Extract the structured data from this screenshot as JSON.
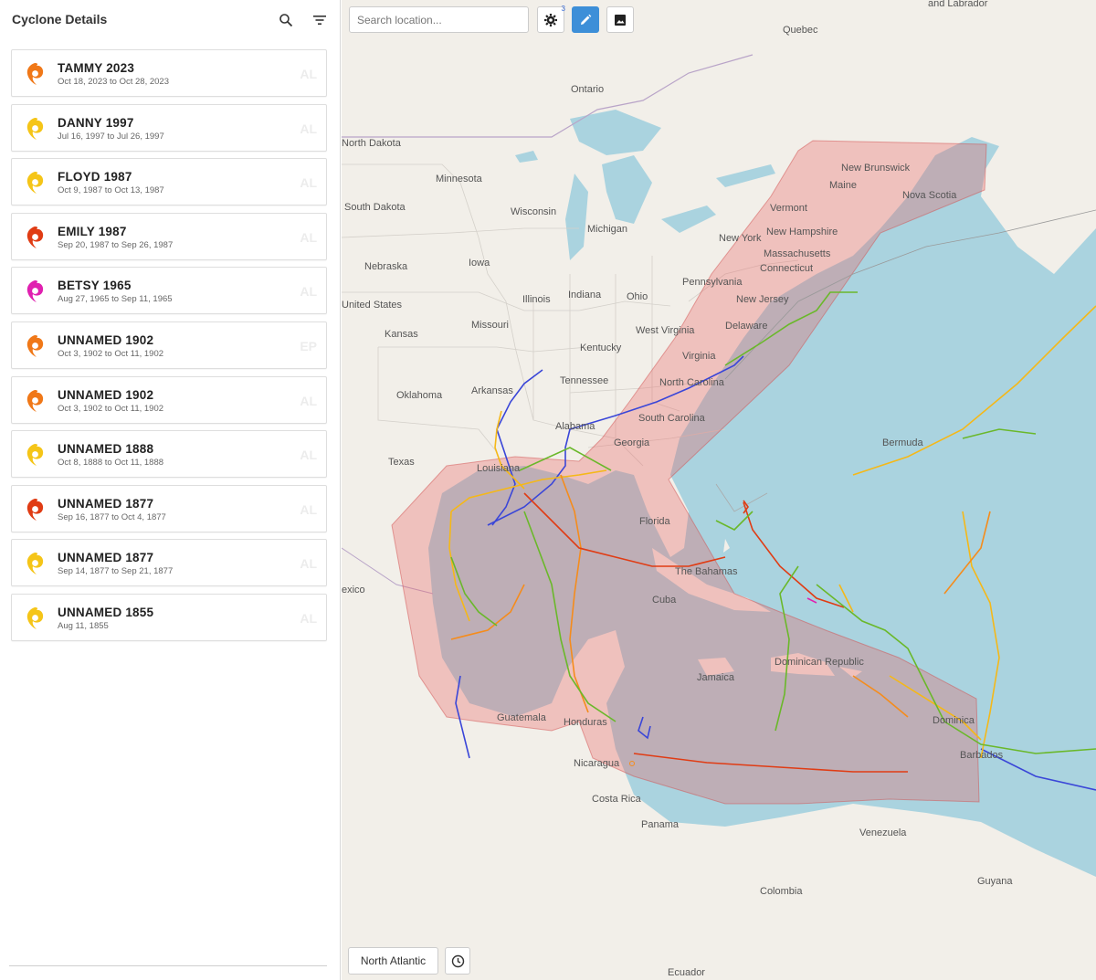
{
  "sidebar": {
    "title": "Cyclone Details",
    "search_icon": "search-icon",
    "filter_icon": "filter-icon"
  },
  "storms": [
    {
      "name": "TAMMY 2023",
      "dates": "Oct 18, 2023 to Oct 28, 2023",
      "basin": "AL",
      "color": "#f07818"
    },
    {
      "name": "DANNY 1997",
      "dates": "Jul 16, 1997 to Jul 26, 1997",
      "basin": "AL",
      "color": "#f5c518"
    },
    {
      "name": "FLOYD 1987",
      "dates": "Oct 9, 1987 to Oct 13, 1987",
      "basin": "AL",
      "color": "#f5c518"
    },
    {
      "name": "EMILY 1987",
      "dates": "Sep 20, 1987 to Sep 26, 1987",
      "basin": "AL",
      "color": "#e03c14"
    },
    {
      "name": "BETSY 1965",
      "dates": "Aug 27, 1965 to Sep 11, 1965",
      "basin": "AL",
      "color": "#e020b0"
    },
    {
      "name": "UNNAMED 1902",
      "dates": "Oct 3, 1902 to Oct 11, 1902",
      "basin": "EP",
      "color": "#f07818"
    },
    {
      "name": "UNNAMED 1902",
      "dates": "Oct 3, 1902 to Oct 11, 1902",
      "basin": "AL",
      "color": "#f07818"
    },
    {
      "name": "UNNAMED 1888",
      "dates": "Oct 8, 1888 to Oct 11, 1888",
      "basin": "AL",
      "color": "#f5c518"
    },
    {
      "name": "UNNAMED 1877",
      "dates": "Sep 16, 1877 to Oct 4, 1877",
      "basin": "AL",
      "color": "#e03c14"
    },
    {
      "name": "UNNAMED 1877",
      "dates": "Sep 14, 1877 to Sep 21, 1877",
      "basin": "AL",
      "color": "#f5c518"
    },
    {
      "name": "UNNAMED 1855",
      "dates": "Aug 11, 1855",
      "basin": "AL",
      "color": "#f5c518"
    }
  ],
  "map": {
    "search_placeholder": "Search location...",
    "settings_badge": "3",
    "settings_icon": "gear-icon",
    "draw_icon": "pencil-icon",
    "image_icon": "image-icon",
    "basin_label": "North Atlantic",
    "history_icon": "clock-icon",
    "labels": {
      "labrador": "and Labrador",
      "quebec": "Quebec",
      "ontario": "Ontario",
      "north_dakota": "North Dakota",
      "minnesota": "Minnesota",
      "south_dakota": "South Dakota",
      "wisconsin": "Wisconsin",
      "michigan": "Michigan",
      "new_brunswick": "New Brunswick",
      "maine": "Maine",
      "nova_scotia": "Nova Scotia",
      "vermont": "Vermont",
      "new_hampshire": "New Hampshire",
      "new_york": "New York",
      "massachusetts": "Massachusetts",
      "connecticut": "Connecticut",
      "nebraska": "Nebraska",
      "iowa": "Iowa",
      "pennsylvania": "Pennsylvania",
      "new_jersey": "New Jersey",
      "illinois": "Illinois",
      "indiana": "Indiana",
      "ohio": "Ohio",
      "united_states": "United States",
      "delaware": "Delaware",
      "missouri": "Missouri",
      "west_virginia": "West Virginia",
      "kansas": "Kansas",
      "kentucky": "Kentucky",
      "virginia": "Virginia",
      "tennessee": "Tennessee",
      "north_carolina": "North Carolina",
      "oklahoma": "Oklahoma",
      "arkansas": "Arkansas",
      "south_carolina": "South Carolina",
      "alabama": "Alabama",
      "georgia": "Georgia",
      "bermuda": "Bermuda",
      "texas": "Texas",
      "louisiana": "Louisiana",
      "florida": "Florida",
      "the_bahamas": "The Bahamas",
      "mexico": "exico",
      "cuba": "Cuba",
      "dominican_republic": "Dominican Republic",
      "jamaica": "Jamaica",
      "guatemala": "Guatemala",
      "honduras": "Honduras",
      "dominica": "Dominica",
      "barbados": "Barbados",
      "nicaragua": "Nicaragua",
      "costa_rica": "Costa Rica",
      "panama": "Panama",
      "venezuela": "Venezuela",
      "guyana": "Guyana",
      "colombia": "Colombia",
      "ecuador": "Ecuador"
    }
  }
}
